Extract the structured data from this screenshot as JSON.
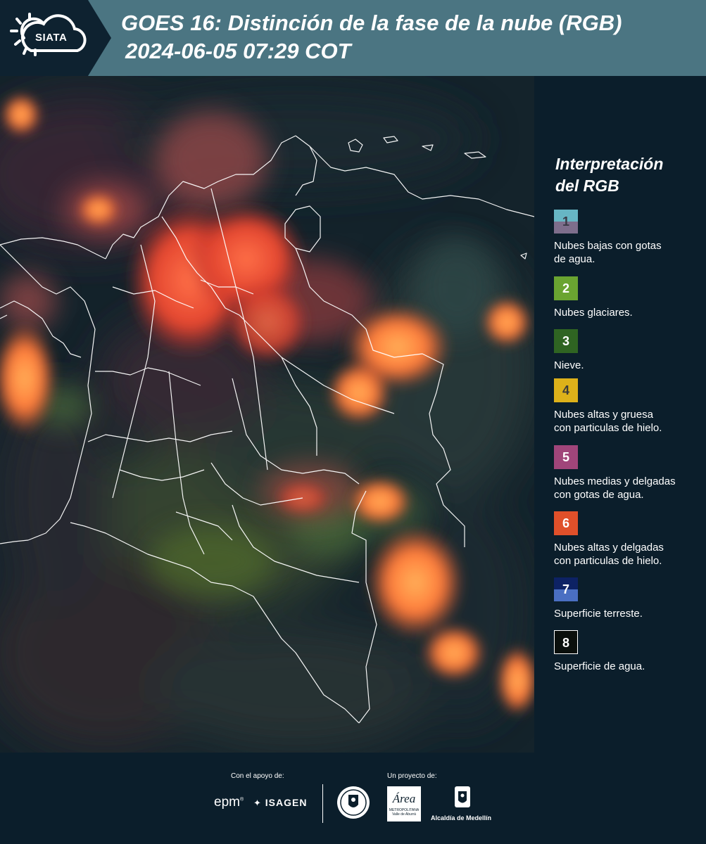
{
  "header": {
    "logo_text": "SIATA",
    "title": "GOES 16: Distinción de la fase de la nube (RGB)",
    "datetime": "2024-06-05 07:29 COT"
  },
  "legend": {
    "title_line1": "Interpretación",
    "title_line2": "del RGB",
    "items": [
      {
        "number": "1",
        "label_line1": "Nubes bajas con gotas",
        "label_line2": "de agua.",
        "color_top": "#67b6c4",
        "color_bottom": "#7e6e8c",
        "num_color": "#3a3a46"
      },
      {
        "number": "2",
        "label_line1": "Nubes glaciares.",
        "label_line2": "",
        "color_top": "#6aa431",
        "color_bottom": "#6aa431",
        "num_color": "#ffffff"
      },
      {
        "number": "3",
        "label_line1": "Nieve.",
        "label_line2": "",
        "color_top": "#2f6422",
        "color_bottom": "#2f6422",
        "num_color": "#ffffff"
      },
      {
        "number": "4",
        "label_line1": "Nubes altas y gruesa",
        "label_line2": "con particulas de hielo.",
        "color_top": "#ddb11a",
        "color_bottom": "#ddb11a",
        "num_color": "#3a3a3a"
      },
      {
        "number": "5",
        "label_line1": "Nubes medias y delgadas",
        "label_line2": "con gotas de agua.",
        "color_top": "#a0457a",
        "color_bottom": "#a0457a",
        "num_color": "#ffffff"
      },
      {
        "number": "6",
        "label_line1": "Nubes altas y delgadas",
        "label_line2": "con particulas de hielo.",
        "color_top": "#e0502a",
        "color_bottom": "#e0502a",
        "num_color": "#ffffff"
      },
      {
        "number": "7",
        "label_line1": "Superficie terreste.",
        "label_line2": "",
        "color_top": "#0d2264",
        "color_bottom": "#4a6fc2",
        "num_color": "#ffffff"
      },
      {
        "number": "8",
        "label_line1": "Superficie de agua.",
        "label_line2": "",
        "color_top": "#0a0f0c",
        "color_bottom": "#0a0f0c",
        "num_color": "#ffffff"
      }
    ]
  },
  "footer": {
    "support_label": "Con el apoyo de:",
    "project_label": "Un proyecto de:",
    "sponsor_epm": "epm",
    "sponsor_isagen": "ISAGEN",
    "area_text": "Área",
    "area_sub1": "METROPOLITANA",
    "area_sub2": "Valle de Aburrá",
    "alcaldia": "Alcaldía de Medellín"
  }
}
